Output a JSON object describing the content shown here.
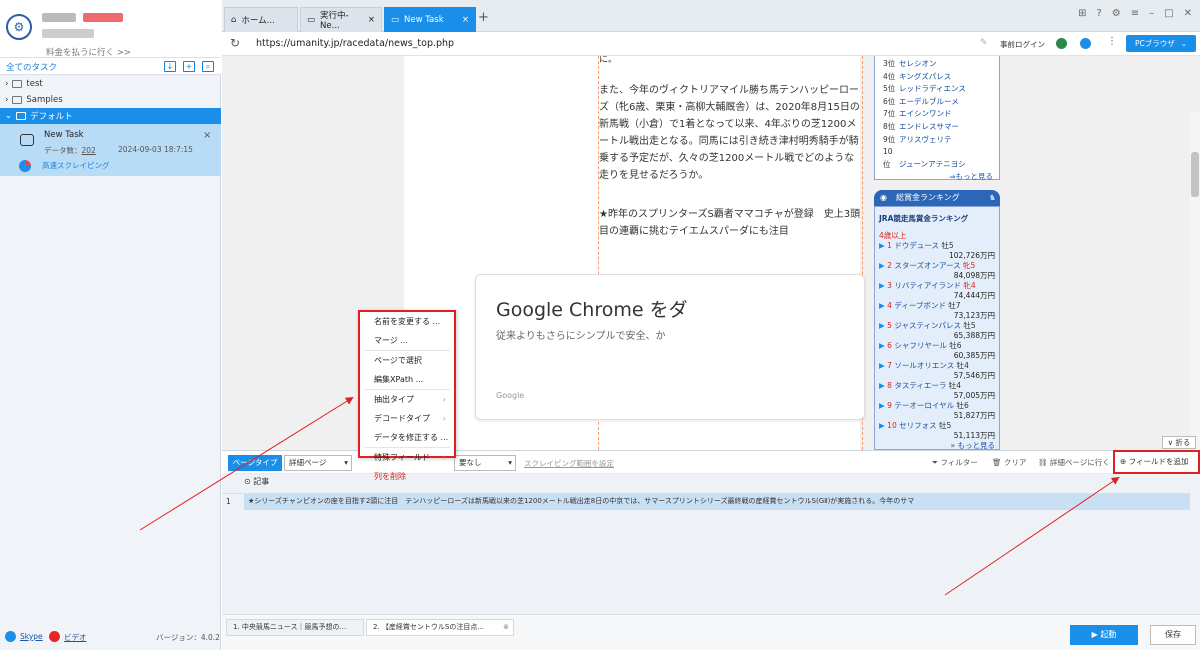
{
  "sidebar": {
    "upgrade_link": "料金を払うに行く >>",
    "all_tasks": "全てのタスク",
    "tree": [
      {
        "label": "test"
      },
      {
        "label": "Samples"
      },
      {
        "label": "デフォルト"
      }
    ],
    "task": {
      "name": "New Task",
      "count_label": "データ数：",
      "count": "202",
      "timestamp": "2024-09-03 18:7:15",
      "mode": "高速スクレイピング"
    },
    "footer": {
      "skype": "Skype",
      "video": "ビデオ",
      "version": "バージョン：4.0.2"
    }
  },
  "tabs": [
    {
      "label": "ホーム..."
    },
    {
      "label": "実行中-Ne..."
    },
    {
      "label": "New Task"
    }
  ],
  "addressbar": {
    "url": "https://umanity.jp/racedata/news_top.php",
    "login": "事前ログイン",
    "browser_button": "PCブラウザ"
  },
  "article": {
    "line0": "に。",
    "para1": [
      "また、今年のヴィクトリアマイル勝ち馬テンハッピーロー",
      "ズ（牝6歳、栗東・高柳大輔厩舎）は、2020年8月15日の",
      "新馬戦（小倉）で1着となって以来、4年ぶりの芝1200メ",
      "ートル戦出走となる。同馬には引き続き津村明秀騎手が騎",
      "乗する予定だが、久々の芝1200メートル戦でどのような",
      "走りを見せるだろうか。"
    ],
    "para2": [
      "★昨年のスプリンターズS覇者ママコチャが登録　史上3頭",
      "目の連覇に挑むテイエムスパーダにも注目"
    ],
    "gcard": {
      "title": "Google Chrome をダ",
      "sub": "従来よりもさらにシンプルで安全、か",
      "brand": "Google"
    }
  },
  "ranking1": {
    "items": [
      {
        "rank": "3位",
        "name": "セレシオン"
      },
      {
        "rank": "4位",
        "name": "キングズパレス"
      },
      {
        "rank": "5位",
        "name": "レッドラディエンス"
      },
      {
        "rank": "6位",
        "name": "エーデルブルーメ"
      },
      {
        "rank": "7位",
        "name": "エイシンワンド"
      },
      {
        "rank": "8位",
        "name": "エンドレスサマー"
      },
      {
        "rank": "9位",
        "name": "アリスヴェリテ"
      },
      {
        "rank": "10位",
        "name": "ジューンアテニヨシ"
      }
    ],
    "more": "⇒もっと見る"
  },
  "ranking2": {
    "header": "総賞金ランキング",
    "subtitle": "JRA競走馬賞金ランキング",
    "age": "4歳以上",
    "items": [
      {
        "rank": "1",
        "name": "ドウデュース",
        "sex": "牡5",
        "prize": "102,726万円"
      },
      {
        "rank": "2",
        "name": "スターズオンアース",
        "sex": "牝5",
        "prize": "84,098万円"
      },
      {
        "rank": "3",
        "name": "リバティアイランド",
        "sex": "牝4",
        "prize": "74,444万円"
      },
      {
        "rank": "4",
        "name": "ディープボンド",
        "sex": "牡7",
        "prize": "73,123万円"
      },
      {
        "rank": "5",
        "name": "ジャスティンパレス",
        "sex": "牡5",
        "prize": "65,388万円"
      },
      {
        "rank": "6",
        "name": "シャフリヤール",
        "sex": "牡6",
        "prize": "60,385万円"
      },
      {
        "rank": "7",
        "name": "ソールオリエンス",
        "sex": "牡4",
        "prize": "57,546万円"
      },
      {
        "rank": "8",
        "name": "タスティエーラ",
        "sex": "牡4",
        "prize": "57,005万円"
      },
      {
        "rank": "9",
        "name": "テーオーロイヤル",
        "sex": "牡6",
        "prize": "51,827万円"
      },
      {
        "rank": "10",
        "name": "セリフォス",
        "sex": "牡5",
        "prize": "51,113万円"
      }
    ],
    "more": "» もっと見る"
  },
  "collapse": "∨ 折る",
  "toolbar": {
    "page_type": "ページタイプ",
    "detail": "詳細ページ",
    "need": "要なし",
    "range": "スクレイピング範囲を設定",
    "filter": "フィルター",
    "clear": "クリア",
    "goto_detail": "詳細ページに行く",
    "add_field": "フィールドを追加"
  },
  "grid": {
    "column": "記事",
    "rows": [
      {
        "num": "1",
        "text": "★シリーズチャンピオンの座を目指す2頭に注目　テンハッピーローズは新馬戦以来の芝1200メートル戦出走8日の中京では、サマースプリントシリーズ最終戦の産経賞セントウルS(GⅡ)が実施される。今年のサマ"
      }
    ]
  },
  "bottom": {
    "tabs": [
      {
        "label": "1. 中央競馬ニュース｜競馬予想の..."
      },
      {
        "label": "2. 【産経賞セントウルSの注目点..."
      }
    ],
    "start": "起動",
    "save": "保存"
  },
  "menu": {
    "items": [
      {
        "label": "名前を変更する ..."
      },
      {
        "label": "マージ ..."
      },
      {
        "label": "ページで選択"
      },
      {
        "label": "編集XPath ..."
      },
      {
        "label": "抽出タイプ"
      },
      {
        "label": "デコードタイプ"
      },
      {
        "label": "データを修正する ..."
      },
      {
        "label": "特殊フィールド"
      },
      {
        "label": "列を削除"
      }
    ]
  }
}
